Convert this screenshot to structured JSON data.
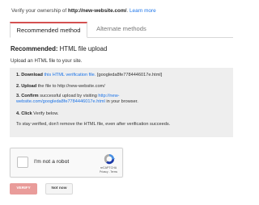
{
  "intro": {
    "prefix": "Verify your ownership of",
    "site": "http://new-website.com/",
    "suffix": ".",
    "learn_more": "Learn more"
  },
  "tabs": {
    "recommended": "Recommended method",
    "alternate": "Alternate methods"
  },
  "heading": {
    "label": "Recommended:",
    "method": "HTML file upload"
  },
  "subtitle": "Upload an HTML file to your site.",
  "steps": {
    "s1_num": "1. Download",
    "s1_link": "this HTML verification file.",
    "s1_file": "[googleda8fe7784446017e.html]",
    "s2_num": "2. Upload",
    "s2_text": "the file to http://new-website.com/",
    "s3_num": "3. Confirm",
    "s3_text": "successful upload by visiting",
    "s3_link_a": "http://new-",
    "s3_link_b": "website.com/googleda8fe7784446017e.html",
    "s3_tail": "in your browser.",
    "s4_num": "4. Click",
    "s4_text": "Verify below.",
    "note": "To stay verified, don't remove the HTML file, even after verification succeeds."
  },
  "captcha": {
    "label": "I'm not a robot",
    "brand": "reCAPTCHA",
    "terms": "Privacy - Terms",
    "logo_colors": [
      "#4a90e2",
      "#1c3aa9",
      "#ababab"
    ]
  },
  "buttons": {
    "verify": "VERIFY",
    "not_now": "Not now"
  },
  "colors": {
    "accent": "#d45151",
    "link": "#1a73e8",
    "verify_bg": "#e99c9a"
  }
}
